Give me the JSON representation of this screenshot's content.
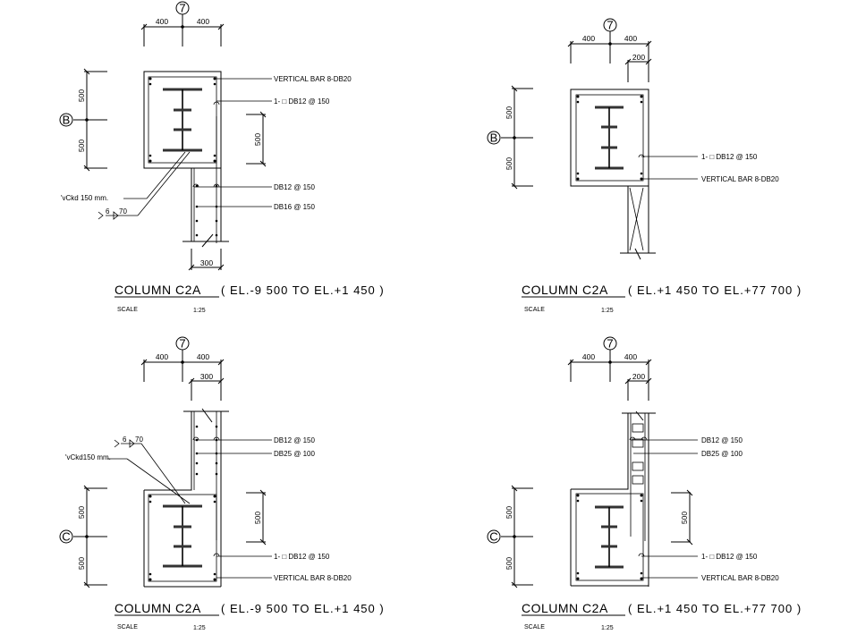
{
  "sheet": {
    "panels": [
      {
        "id": "top-left",
        "grid_col": "7",
        "grid_row": "B",
        "dims_top": [
          "400",
          "400"
        ],
        "dim_web": "",
        "dims_side": [
          "500",
          "500"
        ],
        "dim_right": "500",
        "dim_bottom": "300",
        "callouts": [
          "VERTICAL BAR 8-DB20",
          "1- □ DB12 @ 150",
          "DB12 @ 150",
          "DB16 @ 150"
        ],
        "weld_note": "'vCkd  150 mm.",
        "weld_size": "6",
        "weld_len": "70",
        "title": "COLUMN   C2A",
        "elevation": "( EL.-9 500   TO   EL.+1 450 )",
        "scale_label": "SCALE",
        "scale_value": "1:25"
      },
      {
        "id": "top-right",
        "grid_col": "7",
        "grid_row": "B",
        "dims_top": [
          "400",
          "400"
        ],
        "dim_web": "200",
        "dims_side": [
          "500",
          "500"
        ],
        "callouts": [
          "1- □ DB12 @ 150",
          "VERTICAL BAR 8-DB20"
        ],
        "title": "COLUMN   C2A",
        "elevation": "( EL.+1 450   TO   EL.+77 700 )",
        "scale_label": "SCALE",
        "scale_value": "1:25"
      },
      {
        "id": "bottom-left",
        "grid_col": "7",
        "grid_row": "C",
        "dims_top": [
          "400",
          "400"
        ],
        "dim_web": "300",
        "dims_side": [
          "500",
          "500"
        ],
        "dim_right": "500",
        "callouts": [
          "DB12 @ 150",
          "DB25 @ 100",
          "1- □ DB12 @ 150",
          "VERTICAL BAR 8-DB20"
        ],
        "weld_note": "'vCkd150  mm.",
        "weld_size": "6",
        "weld_len": "70",
        "title": "COLUMN   C2A",
        "elevation": "( EL.-9 500   TO   EL.+1 450 )",
        "scale_label": "SCALE",
        "scale_value": "1:25"
      },
      {
        "id": "bottom-right",
        "grid_col": "7",
        "grid_row": "C",
        "dims_top": [
          "400",
          "400"
        ],
        "dim_web": "200",
        "dims_side": [
          "500",
          "500"
        ],
        "dim_right": "500",
        "callouts": [
          "DB12 @ 150",
          "DB25 @ 100",
          "1- □ DB12 @ 150",
          "VERTICAL BAR 8-DB20"
        ],
        "title": "COLUMN   C2A",
        "elevation": "( EL.+1 450   TO   EL.+77 700 )",
        "scale_label": "SCALE",
        "scale_value": "1:25"
      }
    ]
  }
}
